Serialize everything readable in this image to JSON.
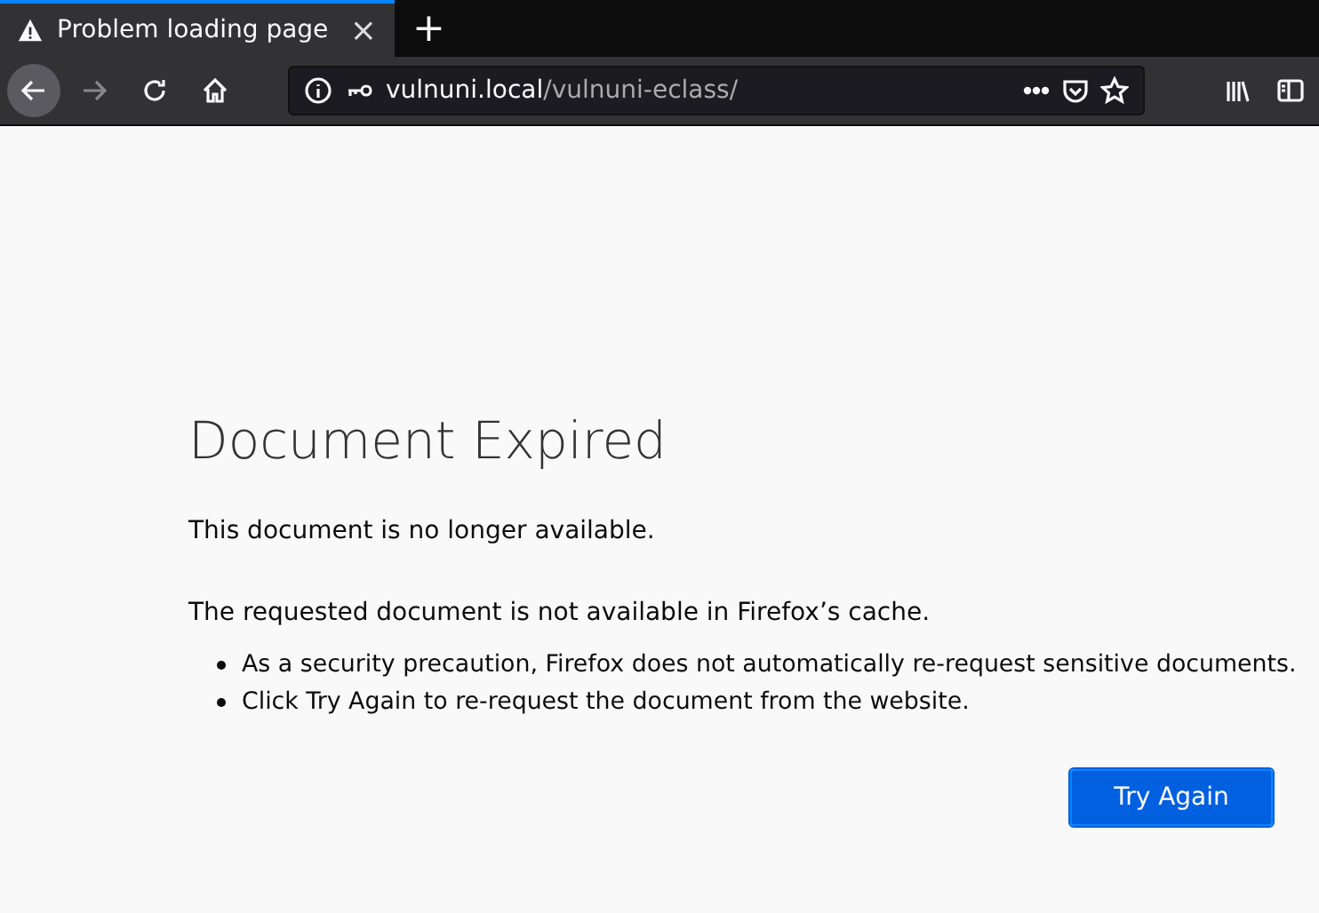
{
  "tab": {
    "title": "Problem loading page",
    "close": "×",
    "selected": true
  },
  "new_tab": "+",
  "url_bar": {
    "host": "vulnuni.local",
    "path": "/vulnuni-eclass/"
  },
  "page": {
    "title": "Document Expired",
    "intro": "This document is no longer available.",
    "detail": "The requested document is not available in Firefox’s cache.",
    "bullets": [
      "As a security precaution, Firefox does not automatically re-request sensitive documents.",
      "Click Try Again to re-request the document from the website."
    ],
    "button": "Try Again"
  }
}
